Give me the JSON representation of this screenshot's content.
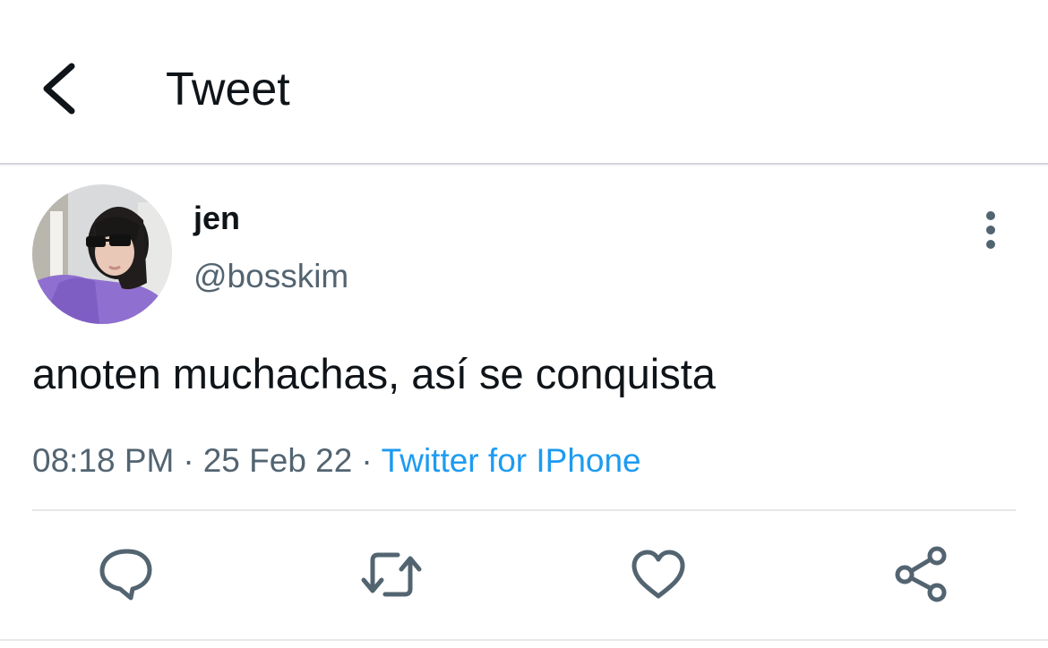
{
  "header": {
    "title": "Tweet",
    "back_icon": "chevron-left-icon"
  },
  "tweet": {
    "author": {
      "display_name": "jen",
      "handle": "@bosskim"
    },
    "text": "anoten muchachas, así se conquista",
    "time": "08:18 PM",
    "date": "25 Feb 22",
    "separator": "·",
    "source": "Twitter for IPhone"
  },
  "actions": [
    {
      "name": "reply",
      "icon": "comment-icon"
    },
    {
      "name": "retweet",
      "icon": "retweet-icon"
    },
    {
      "name": "like",
      "icon": "heart-icon"
    },
    {
      "name": "share",
      "icon": "share-icon"
    }
  ],
  "colors": {
    "text_primary": "#0f1419",
    "text_secondary": "#536471",
    "link": "#1d9bf0",
    "icon": "#536471"
  }
}
